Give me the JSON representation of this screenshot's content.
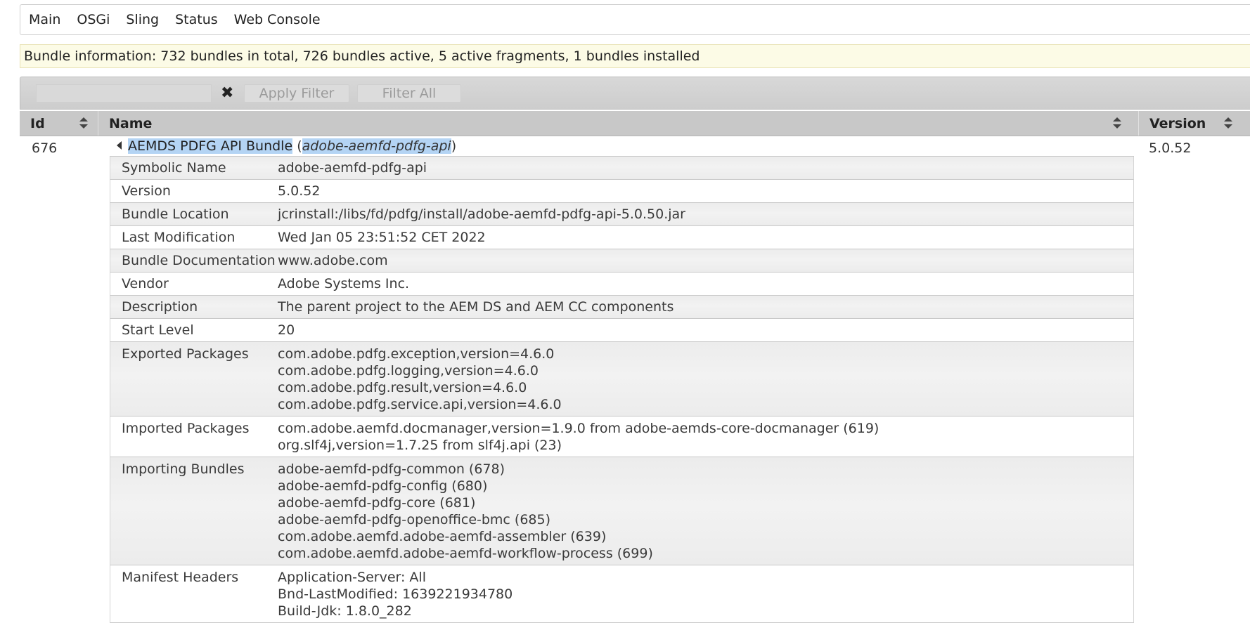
{
  "menu": [
    "Main",
    "OSGi",
    "Sling",
    "Status",
    "Web Console"
  ],
  "info": "Bundle information: 732 bundles in total, 726 bundles active, 5 active fragments, 1 bundles installed",
  "filter": {
    "clear": "✖",
    "apply_label": "Apply Filter",
    "filter_all_label": "Filter All",
    "input_value": ""
  },
  "columns": {
    "id": "Id",
    "name": "Name",
    "version": "Version"
  },
  "bundle": {
    "id": "676",
    "name": "AEMDS PDFG API Bundle",
    "symbolic": "adobe-aemfd-pdfg-api",
    "version": "5.0.52"
  },
  "details": [
    {
      "key": "Symbolic Name",
      "values": [
        "adobe-aemfd-pdfg-api"
      ]
    },
    {
      "key": "Version",
      "values": [
        "5.0.52"
      ]
    },
    {
      "key": "Bundle Location",
      "values": [
        "jcrinstall:/libs/fd/pdfg/install/adobe-aemfd-pdfg-api-5.0.50.jar"
      ]
    },
    {
      "key": "Last Modification",
      "values": [
        "Wed Jan 05 23:51:52 CET 2022"
      ]
    },
    {
      "key": "Bundle Documentation",
      "values": [
        "www.adobe.com"
      ]
    },
    {
      "key": "Vendor",
      "values": [
        "Adobe Systems Inc."
      ]
    },
    {
      "key": "Description",
      "values": [
        "The parent project to the AEM DS and AEM CC components"
      ]
    },
    {
      "key": "Start Level",
      "values": [
        "20"
      ]
    },
    {
      "key": "Exported Packages",
      "values": [
        "com.adobe.pdfg.exception,version=4.6.0",
        "com.adobe.pdfg.logging,version=4.6.0",
        "com.adobe.pdfg.result,version=4.6.0",
        "com.adobe.pdfg.service.api,version=4.6.0"
      ]
    },
    {
      "key": "Imported Packages",
      "values": [
        "com.adobe.aemfd.docmanager,version=1.9.0 from adobe-aemds-core-docmanager (619)",
        "org.slf4j,version=1.7.25 from slf4j.api (23)"
      ]
    },
    {
      "key": "Importing Bundles",
      "values": [
        "adobe-aemfd-pdfg-common (678)",
        "adobe-aemfd-pdfg-config (680)",
        "adobe-aemfd-pdfg-core (681)",
        "adobe-aemfd-pdfg-openoffice-bmc (685)",
        "com.adobe.aemfd.adobe-aemfd-assembler (639)",
        "com.adobe.aemfd.adobe-aemfd-workflow-process (699)"
      ]
    },
    {
      "key": "Manifest Headers",
      "values": [
        "Application-Server: All",
        "Bnd-LastModified: 1639221934780",
        "Build-Jdk: 1.8.0_282"
      ]
    }
  ]
}
